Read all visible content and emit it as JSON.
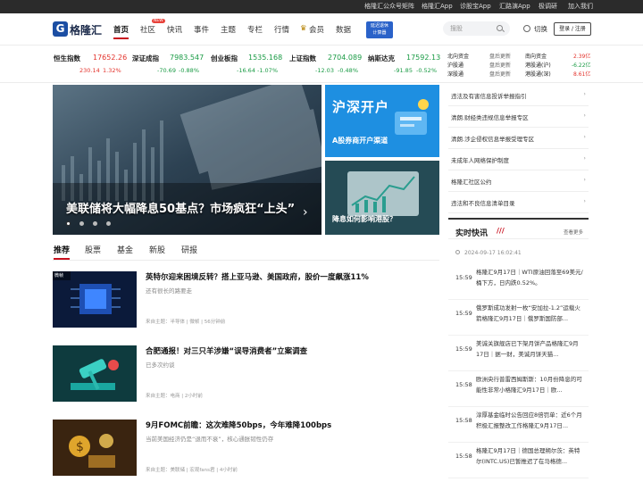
{
  "topbar": {
    "links": [
      "格隆汇公众号矩阵",
      "格隆汇App",
      "诊股宝App",
      "汇路演App",
      "极调研",
      "加入我们"
    ]
  },
  "logo": {
    "text": "格隆汇",
    "mark": "G"
  },
  "nav": {
    "items": [
      "首页",
      "社区",
      "快讯",
      "事件",
      "主题",
      "专栏",
      "行情",
      "会员",
      "数据"
    ],
    "new_badge": "NEW",
    "calc": [
      "延迟退休",
      "计算器"
    ]
  },
  "search": {
    "placeholder": "搜股"
  },
  "switch_label": "切换",
  "login_label": "登录 / 注册",
  "tickers": [
    {
      "name": "恒生指数",
      "price": "17652.26",
      "chg": "230.14",
      "pct": "1.32%",
      "dir": "up"
    },
    {
      "name": "深证成指",
      "price": "7983.547",
      "chg": "-70.69",
      "pct": "-0.88%",
      "dir": "dn"
    },
    {
      "name": "创业板指",
      "price": "1535.168",
      "chg": "-16.64",
      "pct": "-1.07%",
      "dir": "dn"
    },
    {
      "name": "上证指数",
      "price": "2704.089",
      "chg": "-12.03",
      "pct": "-0.48%",
      "dir": "dn"
    },
    {
      "name": "纳斯达克",
      "price": "17592.13",
      "chg": "-91.85",
      "pct": "-0.52%",
      "dir": "dn"
    }
  ],
  "flows": [
    {
      "name": "北向资金",
      "status": "盘后更新",
      "name2": "南向资金",
      "val2": "2.39亿",
      "dir": "up"
    },
    {
      "name": "沪股通",
      "status": "盘后更新",
      "name2": "港股通(沪)",
      "val2": "-6.22亿",
      "dir": "dn"
    },
    {
      "name": "深股通",
      "status": "盘后更新",
      "name2": "港股通(深)",
      "val2": "8.61亿",
      "dir": "up"
    }
  ],
  "hero": {
    "caption": "美联储将大幅降息50基点？市场疯狂“上头”"
  },
  "banner1": {
    "big": "沪深开户",
    "caption": "A股券商开户渠道"
  },
  "banner2": {
    "caption": "降息如何影响港股？"
  },
  "right_links": [
    "违法及有害信息投诉举报指引",
    "清朗.财经类违规信息举报专区",
    "清朗.涉企侵权信息举报受理专区",
    "未成年人网络保护制度",
    "格隆汇社区公约",
    "违法和不良信息清单目录"
  ],
  "tabs": [
    "推荐",
    "股票",
    "基金",
    "新股",
    "研报"
  ],
  "articles": [
    {
      "title": "英特尔迎来困境反转？搭上亚马逊、美国政府，股价一度飙涨11%",
      "sub": "还有很长的路要走",
      "meta": "来自主题：半导体 | 微帧 | 56分钟前",
      "tag": "微帧"
    },
    {
      "title": "合肥通报！对三只羊涉嫌“误导消费者”立案调查",
      "sub": "已多次约谈",
      "meta": "来自主题：电商 | 2小时前",
      "tag": ""
    },
    {
      "title": "9月FOMC前瞻：这次难降50bps，今年难降100bps",
      "sub": "当前美国经济仍是“退而不衰”，核心通胀韧性仍存",
      "meta": "来自主题：美联储 | 宏观fans君 | 4小时前",
      "tag": ""
    }
  ],
  "flash": {
    "title": "实时快讯",
    "more": "查看更多",
    "date": "2024-09-17 16:02:41",
    "items": [
      {
        "time": "15:59",
        "text": "格隆汇9月17日｜WTI原油回落至69美元/桶下方，日内跌0.52%。"
      },
      {
        "time": "15:59",
        "text": "俄罗斯成功发射一枚“安加拉-1.2”运载火箭格隆汇9月17日｜俄罗斯国防部..."
      },
      {
        "time": "15:59",
        "text": "美诚关旗舰店已下架月饼产品格隆汇9月17日｜据一财，美诚月饼天猫..."
      },
      {
        "time": "15:58",
        "text": "欧洲央行普雷西姆斯斯：10月份降息的可能性非常小格隆汇9月17日｜欧..."
      },
      {
        "time": "15:58",
        "text": "淳厚基金临时公告回应8倍罚单：近6个月积极汇报整改工作格隆汇9月17日..."
      },
      {
        "time": "15:58",
        "text": "格隆汇9月17日｜德国总理朔尔茨：英特尔(INTC.US)已暂推迟了在马格德..."
      }
    ]
  }
}
